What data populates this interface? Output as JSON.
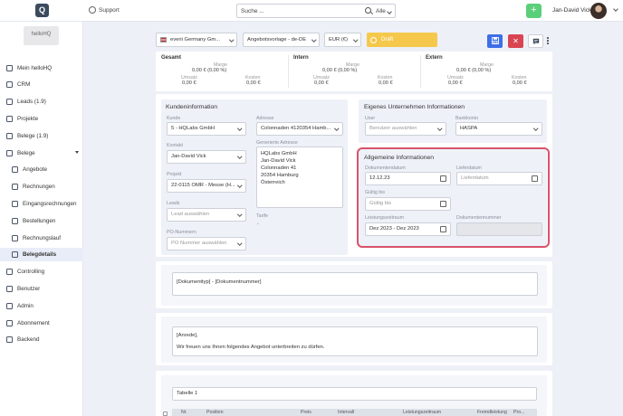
{
  "topbar": {
    "logo_text": "Q",
    "support_label": "Support",
    "search_placeholder": "Suche ...",
    "search_scope": "Alle",
    "add_label": "+",
    "user_name": "Jan-David Vick"
  },
  "sidebar": {
    "brand": "helloHQ",
    "items": [
      {
        "label": "Mein helloHQ",
        "icon": "dashboard-icon"
      },
      {
        "label": "CRM",
        "icon": "crm-icon"
      },
      {
        "label": "Leads (1.9)",
        "icon": "leads-icon"
      },
      {
        "label": "Projekte",
        "icon": "projects-icon"
      },
      {
        "label": "Belege (1.9)",
        "icon": "documents-icon"
      },
      {
        "label": "Belege",
        "icon": "documents-icon"
      },
      {
        "label": "Angebote",
        "icon": "offer-icon"
      },
      {
        "label": "Rechnungen",
        "icon": "invoice-icon"
      },
      {
        "label": "Eingangsrechnungen",
        "icon": "incoming-invoice-icon"
      },
      {
        "label": "Bestellungen",
        "icon": "order-icon"
      },
      {
        "label": "Rechnungslauf",
        "icon": "invoice-run-icon"
      },
      {
        "label": "Belegdetails",
        "icon": "document-detail-icon"
      },
      {
        "label": "Controlling",
        "icon": "controlling-icon"
      },
      {
        "label": "Benutzer",
        "icon": "users-icon"
      },
      {
        "label": "Admin",
        "icon": "admin-icon"
      },
      {
        "label": "Abonnement",
        "icon": "subscription-icon"
      },
      {
        "label": "Backend",
        "icon": "backend-icon"
      }
    ]
  },
  "toolbar": {
    "company": "everii Germany Gm...",
    "template": "Angebotsvorlage - de-DE",
    "currency": "EUR (€)",
    "status": "Draft",
    "save_icon": "floppy-icon",
    "cancel_label": "✕",
    "comment_icon": "comment-icon",
    "colors": {
      "save": "#3e6ee8",
      "cancel": "#d94452",
      "draft": "#f5c84c"
    }
  },
  "summary": [
    {
      "title": "Gesamt",
      "marge_label": "Marge",
      "marge_value": "0,00 € (0,00 %)",
      "umsatz_label": "Umsatz",
      "umsatz_value": "0,00 €",
      "kosten_label": "Kosten",
      "kosten_value": "0,00 €"
    },
    {
      "title": "Intern",
      "marge_label": "Marge",
      "marge_value": "0,00 € (0,00 %)",
      "umsatz_label": "Umsatz",
      "umsatz_value": "0,00 €",
      "kosten_label": "Kosten",
      "kosten_value": "0,00 €"
    },
    {
      "title": "Extern",
      "marge_label": "Marge",
      "marge_value": "0,00 € (0,00 %)",
      "umsatz_label": "Umsatz",
      "umsatz_value": "0,00 €",
      "kosten_label": "Kosten",
      "kosten_value": "0,00 €"
    }
  ],
  "kunden": {
    "title": "Kundeninformation",
    "kunde_label": "Kunde",
    "kunde_value": "5 - HQLabs GmbH",
    "kontakt_label": "Kontakt",
    "kontakt_value": "Jan-David Vick",
    "projekt_label": "Projekt",
    "projekt_value": "22-0115 OMR - Messe (H...",
    "leads_label": "Leads",
    "leads_placeholder": "Lead auswählen",
    "po_label": "PO-Nummern",
    "po_placeholder": "PO Nummer auswählen",
    "adresse_label": "Adresse",
    "adresse_value": "Colonnaden 4120354 Hamb...",
    "generiere_label": "Generierte Adresse",
    "generiere_lines": [
      "HQLabs GmbH",
      "Jan-David Vick",
      "Colonnaden 41",
      "20354 Hamburg",
      "Österreich"
    ],
    "tarife_label": "Tarife",
    "tarife_value": "-"
  },
  "eigenes": {
    "title": "Eigenes Unternehmen Informationen",
    "user_label": "User",
    "user_placeholder": "Benutzer auswählen",
    "bank_label": "Bankkonto",
    "bank_value": "HASPA"
  },
  "allgemein": {
    "title": "Allgemeine Informationen",
    "dokdatum_label": "Dokumentendatum",
    "dokdatum_value": "12.12.23",
    "lieferdatum_label": "Lieferdatum",
    "lieferdatum_placeholder": "Lieferdatum",
    "gueltig_label": "Gültig bis",
    "gueltig_placeholder": "Gültig bis",
    "leistung_label": "Leistungszeitraum",
    "leistung_value": "Dez 2023 - Dez 2023",
    "doknr_label": "Dokumentennummer",
    "doknr_value": ""
  },
  "doc_title_field": "[Dokumenttyp] - [Dokumentnummer]",
  "intro": {
    "line1": "[Anrede],",
    "line2": "Wir freuen uns Ihnen folgendes Angebot unterbreiten zu dürfen."
  },
  "table": {
    "title": "Tabelle 1",
    "columns": [
      "Nr.",
      "Position",
      "Preis",
      "Intervall",
      "Leistungszeitraum",
      "Fremdleistung",
      "Pro..."
    ]
  }
}
